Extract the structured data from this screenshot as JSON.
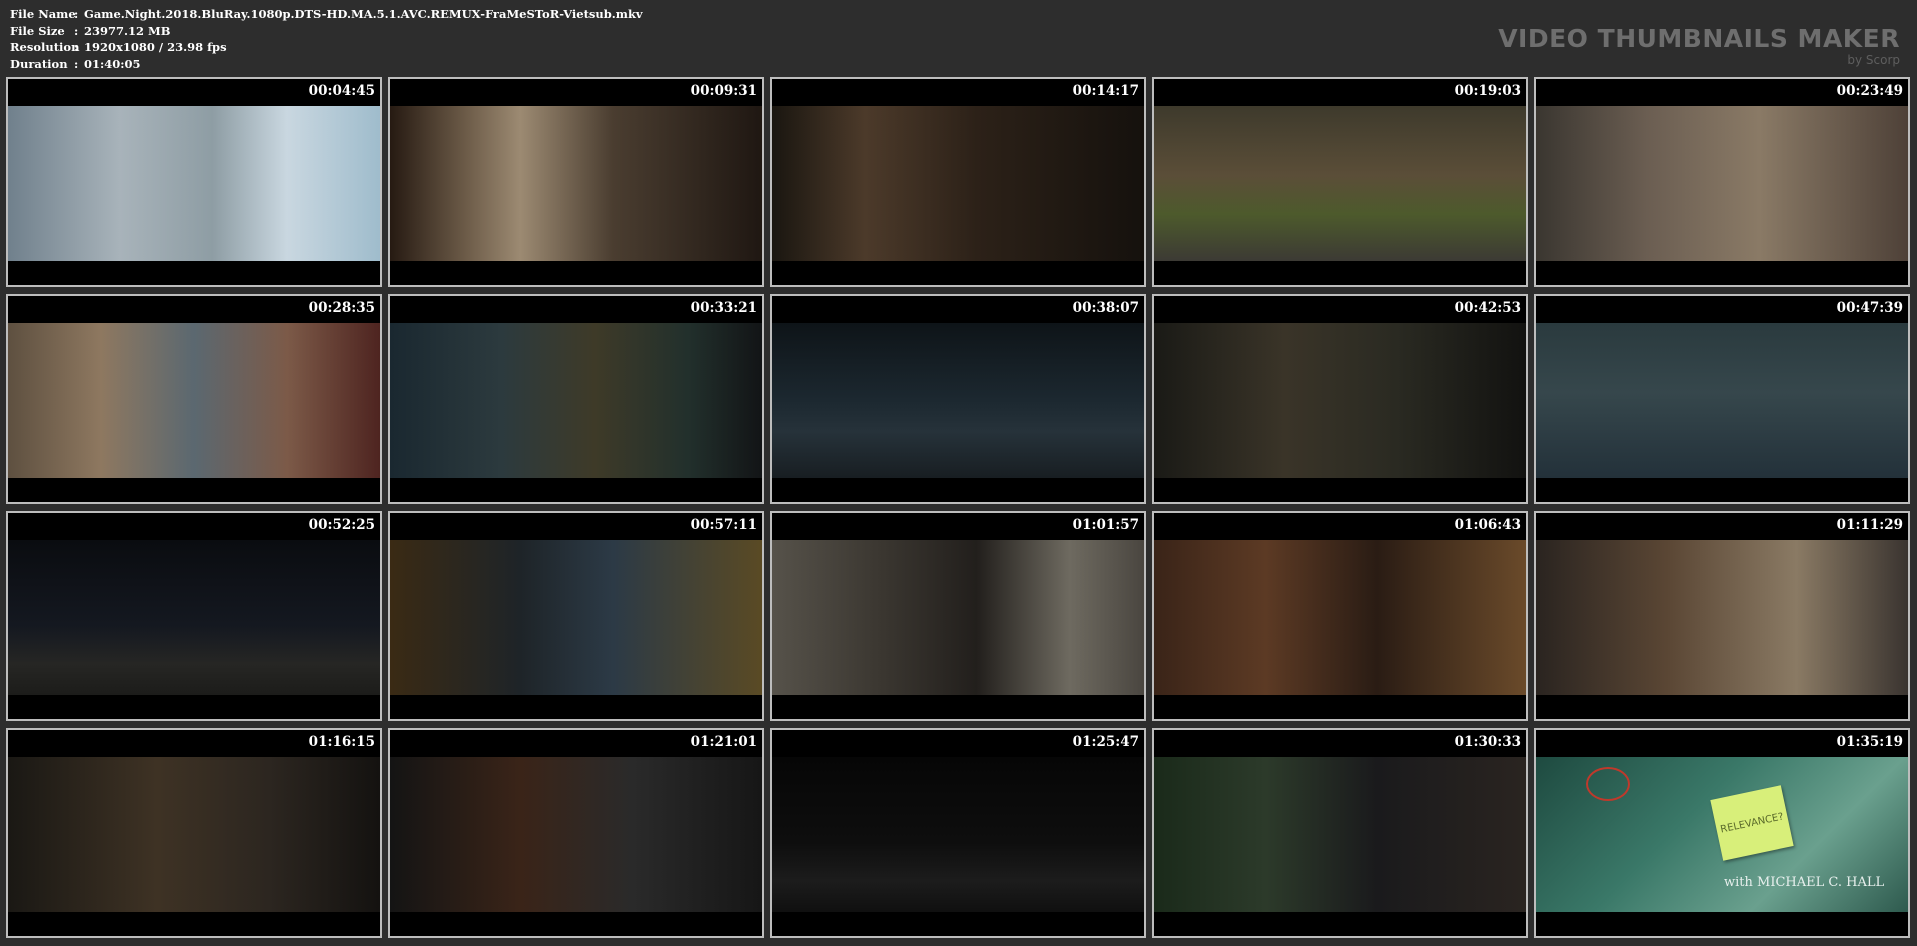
{
  "file_info": {
    "filename_label": "File Name",
    "filename": "Game.Night.2018.BluRay.1080p.DTS-HD.MA.5.1.AVC.REMUX-FraMeSToR-Vietsub.mkv",
    "filesize_label": "File Size",
    "filesize": "23977.12 MB",
    "resolution_label": "Resolution",
    "resolution": "1920x1080 / 23.98 fps",
    "duration_label": "Duration",
    "duration": "01:40:05",
    "separator": ":"
  },
  "brand": {
    "title": "VIDEO THUMBNAILS MAKER",
    "subtitle": "by Scorp"
  },
  "thumbnails": [
    {
      "time": "00:04:45",
      "scene_icon": "scene-office-window"
    },
    {
      "time": "00:09:31",
      "scene_icon": "scene-man-smiling"
    },
    {
      "time": "00:14:17",
      "scene_icon": "scene-men-talking"
    },
    {
      "time": "00:19:03",
      "scene_icon": "scene-man-with-dog"
    },
    {
      "time": "00:23:49",
      "scene_icon": "scene-couple-watching"
    },
    {
      "time": "00:28:35",
      "scene_icon": "scene-couple-couch"
    },
    {
      "time": "00:33:21",
      "scene_icon": "scene-bar-interior"
    },
    {
      "time": "00:38:07",
      "scene_icon": "scene-man-night-street"
    },
    {
      "time": "00:42:53",
      "scene_icon": "scene-man-on-floor"
    },
    {
      "time": "00:47:39",
      "scene_icon": "scene-night-parking"
    },
    {
      "time": "00:52:25",
      "scene_icon": "scene-walking-night"
    },
    {
      "time": "00:57:11",
      "scene_icon": "scene-closeup-face"
    },
    {
      "time": "01:01:57",
      "scene_icon": "scene-mansion-entrance"
    },
    {
      "time": "01:06:43",
      "scene_icon": "scene-study-room"
    },
    {
      "time": "01:11:29",
      "scene_icon": "scene-living-room"
    },
    {
      "time": "01:16:15",
      "scene_icon": "scene-men-on-bridge"
    },
    {
      "time": "01:21:01",
      "scene_icon": "scene-men-street-night"
    },
    {
      "time": "01:25:47",
      "scene_icon": "scene-airport-stairs"
    },
    {
      "time": "01:30:33",
      "scene_icon": "scene-alley-night"
    },
    {
      "time": "01:35:19",
      "scene_icon": "scene-relevance-note",
      "overlay_note": "RELEVANCE?",
      "overlay_credit": "with MICHAEL C. HALL"
    }
  ]
}
